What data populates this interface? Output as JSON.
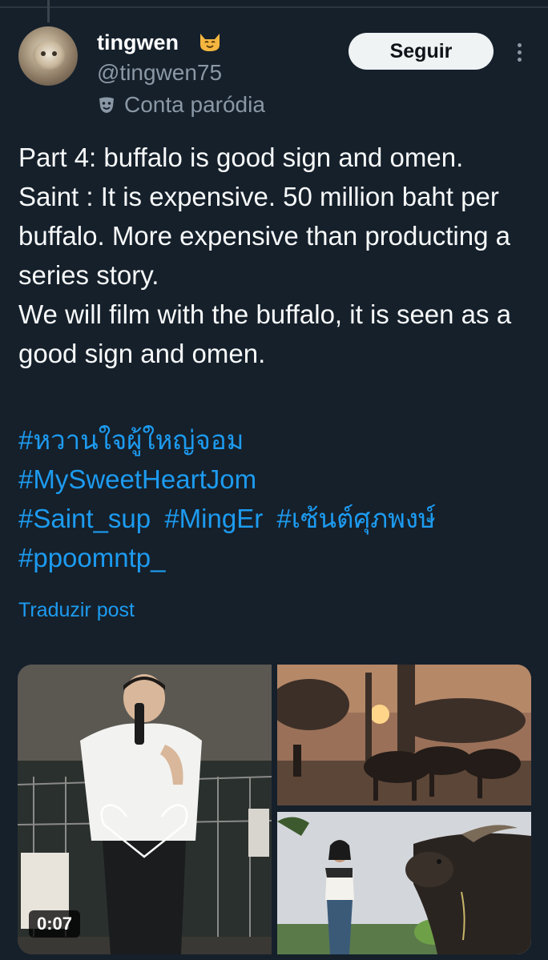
{
  "author": {
    "display_name": "tingwen",
    "name_emoji": "cat-face-emoji",
    "handle": "@tingwen75",
    "account_label": "Conta paródia",
    "account_icon": "theater-mask-icon"
  },
  "actions": {
    "follow_label": "Seguir",
    "more_icon": "more-vertical-icon"
  },
  "post": {
    "text": "Part 4: buffalo is good sign and omen.\nSaint : It is expensive. 50 million baht per buffalo. More expensive than producting a series story.\nWe will film with the buffalo, it is seen as a good sign and omen.",
    "hashtags": [
      "#หวานใจผู้ใหญ่จอม",
      "#MySweetHeartJom",
      "#Saint_sup",
      "#MingEr",
      "#เซ้นต์ศุภพงษ์",
      "#ppoomntp_"
    ],
    "translate_label": "Traduzir post"
  },
  "media": {
    "video_duration": "0:07"
  },
  "colors": {
    "background": "#15202b",
    "text_primary": "#f7f9f9",
    "text_secondary": "#8b98a5",
    "accent": "#1d9bf0",
    "button_bg": "#eff3f4"
  }
}
